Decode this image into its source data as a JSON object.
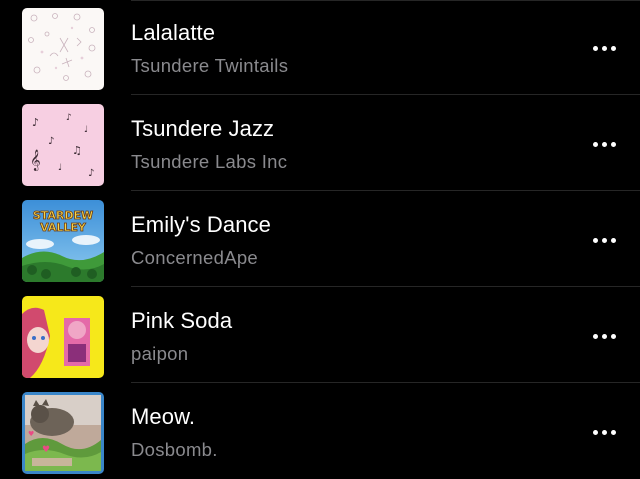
{
  "tracks": [
    {
      "title": "Lalalatte",
      "artist": "Tsundere Twintails"
    },
    {
      "title": "Tsundere Jazz",
      "artist": "Tsundere Labs Inc"
    },
    {
      "title": "Emily's Dance",
      "artist": "ConcernedApe"
    },
    {
      "title": "Pink Soda",
      "artist": "paipon"
    },
    {
      "title": "Meow.",
      "artist": "Dosbomb."
    }
  ],
  "artwork_text": {
    "stardew": "STARDEW VALLEY"
  },
  "colors": {
    "background": "#000000",
    "title": "#ffffff",
    "subtitle": "#8a8a8e",
    "divider": "#262626"
  },
  "icons": {
    "more": "more-horizontal-icon"
  }
}
